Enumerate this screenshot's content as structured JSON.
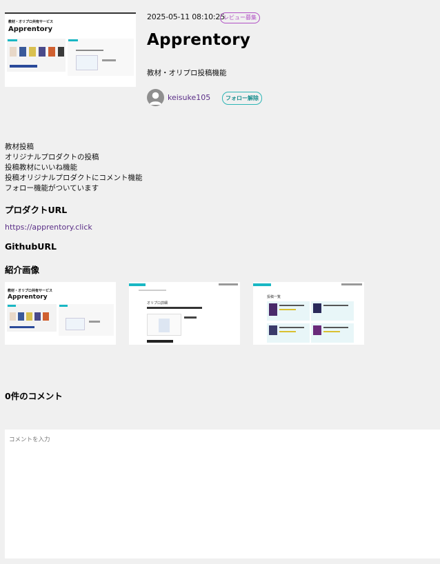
{
  "hero_thumbnail": {
    "label": "教材・オリプロ共有サービス",
    "title": "Apprentory"
  },
  "header": {
    "timestamp": "2025-05-11 08:10:25",
    "badge": "レビュー募集",
    "title": "Apprentory",
    "subtitle": "教材・オリプロ投稿機能"
  },
  "author": {
    "name": "keisuke105",
    "follow_label": "フォロー解除"
  },
  "description_lines": [
    "教材投稿",
    "オリジナルプロダクトの投稿",
    "投稿教材にいいね機能",
    "投稿オリジナルプロダクトにコメント機能",
    "フォロー機能がついています"
  ],
  "sections": {
    "product_url_heading": "プロダクトURL",
    "product_url": "https://apprentory.click",
    "github_url_heading": "GithubURL",
    "images_heading": "紹介画像"
  },
  "intro_images": [
    {
      "label": "教材・オリプロ共有サービス",
      "title": "Apprentory"
    },
    {
      "label": "オリプロ詳細"
    },
    {
      "label": "投稿一覧"
    }
  ],
  "comments": {
    "heading": "0件のコメント",
    "placeholder": "コメントを入力"
  },
  "colors": {
    "page_bg": "#f0f0f0",
    "badge": "#b04fc4",
    "follow": "#2cb5b5",
    "link": "#5a2e87",
    "teal_bar": "#19b7c4"
  }
}
